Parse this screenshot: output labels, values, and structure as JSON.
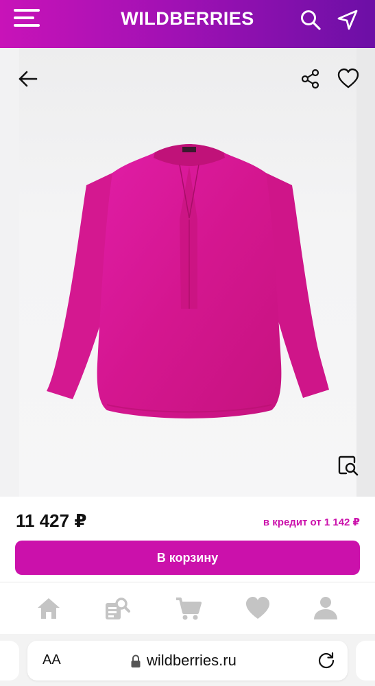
{
  "header": {
    "logo": "WILDBERRIES",
    "icons": [
      "menu-icon",
      "search-icon",
      "geolocation-icon"
    ],
    "gradient": [
      "#c813b8",
      "#6c0fa6"
    ]
  },
  "product": {
    "icons": [
      "back-arrow-icon",
      "share-icon",
      "heart-icon",
      "image-search-icon"
    ],
    "image_color": "#d6189a",
    "price": "11 427 ₽",
    "credit": "в кредит от 1 142 ₽"
  },
  "actions": {
    "cart_label": "В корзину",
    "accent": "#cb11ab"
  },
  "bottom_nav": {
    "items": [
      "home-icon",
      "catalog-icon",
      "cart-icon",
      "favorites-icon",
      "profile-icon"
    ],
    "icon_color": "#c4c4c4"
  },
  "browser": {
    "text_size_label": "AA",
    "url": "wildberries.ru"
  }
}
